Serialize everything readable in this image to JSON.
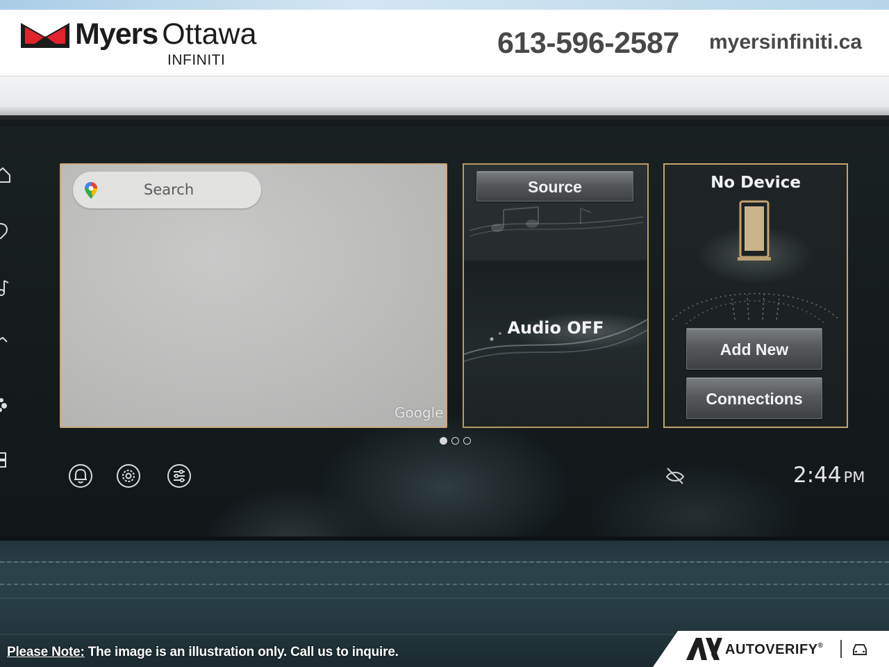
{
  "dealer": {
    "name_bold": "Myers",
    "name_light": "Ottawa",
    "brand": "INFINITI",
    "phone": "613-596-2587",
    "website": "myersinfiniti.ca",
    "logo_colors": {
      "red": "#e3232b",
      "dark": "#1c1c1c"
    }
  },
  "screen": {
    "left_rail_icons": [
      "home-icon",
      "location-pin-icon",
      "music-note-icon",
      "nav-arrow-icon",
      "apps-icon",
      "grid-icon"
    ],
    "map": {
      "search_placeholder": "Search",
      "attribution": "Google",
      "pin_icon": "google-maps-pin-icon"
    },
    "audio": {
      "source_label": "Source",
      "status": "Audio OFF"
    },
    "device": {
      "title": "No Device",
      "add_new_label": "Add New",
      "connections_label": "Connections"
    },
    "pager": {
      "count": 3,
      "active": 0
    },
    "bottom_icons": [
      "notification-bell-icon",
      "settings-gear-icon",
      "adjust-sliders-icon"
    ],
    "status_icon": "mute-icon",
    "clock": {
      "time": "2:44",
      "ampm": "PM"
    },
    "accent_color": "#c4a46e"
  },
  "footer": {
    "note_lead": "Please Note:",
    "note_text": " The image is an illustration only. Call us to inquire.",
    "verifier": "AUTOVERIFY",
    "verifier_mark": "®"
  }
}
